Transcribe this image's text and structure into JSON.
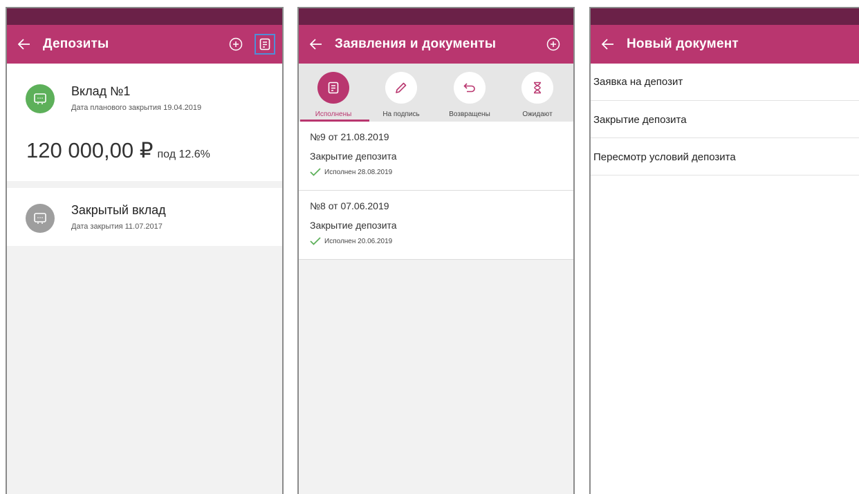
{
  "panel1": {
    "title": "Депозиты",
    "deposits": [
      {
        "name": "Вклад №1",
        "subtitle": "Дата планового закрытия 19.04.2019",
        "amount": "120 000,00 ₽",
        "rate": "под 12.6%",
        "icon_color": "#5db05a"
      },
      {
        "name": "Закрытый вклад",
        "subtitle": "Дата закрытия 11.07.2017",
        "icon_color": "#9e9e9e"
      }
    ]
  },
  "panel2": {
    "title": "Заявления и документы",
    "tabs": [
      {
        "label": "Исполнены",
        "icon": "document-icon",
        "active": true
      },
      {
        "label": "На подпись",
        "icon": "pen-icon",
        "active": false
      },
      {
        "label": "Возвращены",
        "icon": "return-arrow-icon",
        "active": false
      },
      {
        "label": "Ожидают",
        "icon": "hourglass-icon",
        "active": false
      }
    ],
    "documents": [
      {
        "number": "№9 от 21.08.2019",
        "type": "Закрытие депозита",
        "status": "Исполнен 28.08.2019"
      },
      {
        "number": "№8 от 07.06.2019",
        "type": "Закрытие депозита",
        "status": "Исполнен 20.06.2019"
      }
    ]
  },
  "panel3": {
    "title": "Новый документ",
    "items": [
      "Заявка на депозит",
      "Закрытие депозита",
      "Пересмотр условий депозита"
    ]
  },
  "colors": {
    "status_bar": "#6b2148",
    "app_bar": "#b9366f",
    "accent": "#b9366f",
    "success": "#5db05a",
    "highlight_border": "#4f8ed8"
  }
}
